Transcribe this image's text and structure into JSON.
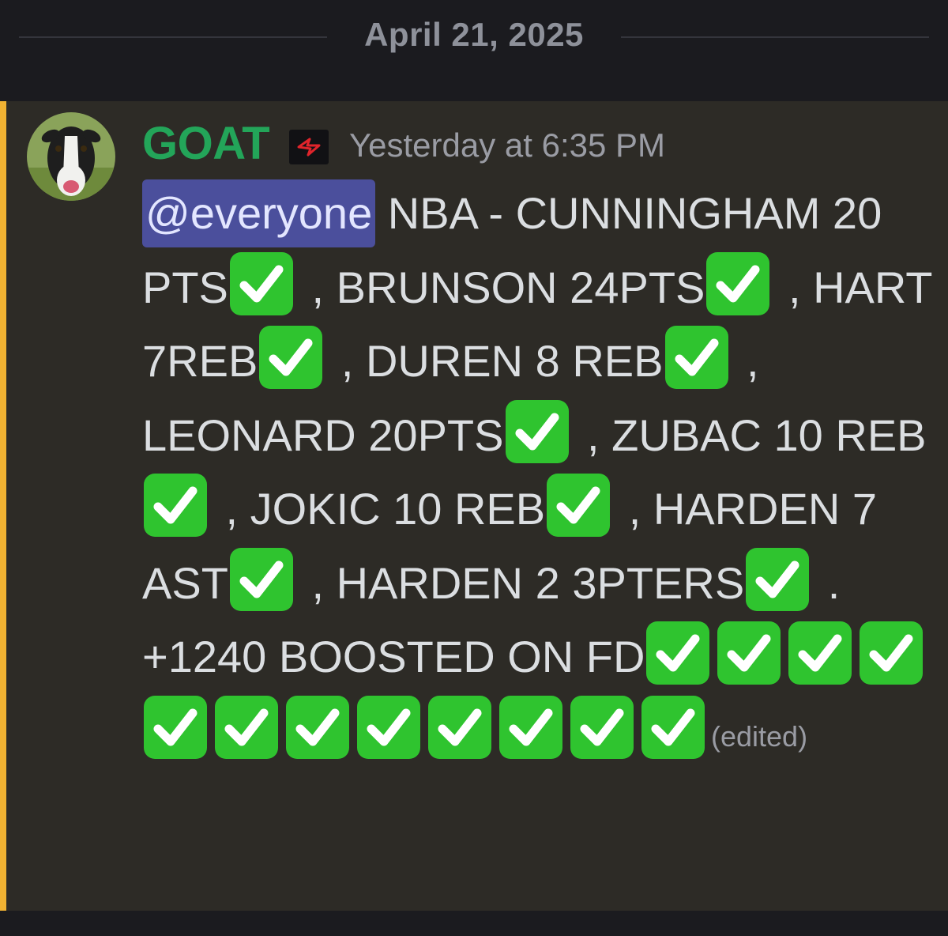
{
  "divider": {
    "date": "April 21, 2025"
  },
  "message": {
    "author": "GOAT",
    "author_color": "#23a559",
    "timestamp": "Yesterday at 6:35 PM",
    "mention": "@everyone",
    "segments": [
      " NBA - CUNNINGHAM 20 PTS",
      " , BRUNSON 24PTS",
      " , HART 7REB",
      " , DUREN 8 REB",
      " , LEONARD 20PTS",
      " , ZUBAC 10 REB",
      " , JOKIC 10 REB",
      " , HARDEN 7 AST",
      " , HARDEN 2 3PTERS",
      " .  +1240 BOOSTED ON FD"
    ],
    "trailing_check_count": 12,
    "edited_label": "(edited)"
  },
  "icons": {
    "check": "white-heavy-check-mark-icon",
    "badge": "role-badge-icon",
    "avatar": "goat-avatar"
  },
  "colors": {
    "check_green": "#2fc42f",
    "mention_bg": "#4b4f9c",
    "highlight_bar": "#f0b232",
    "message_bg": "#2d2b26"
  }
}
